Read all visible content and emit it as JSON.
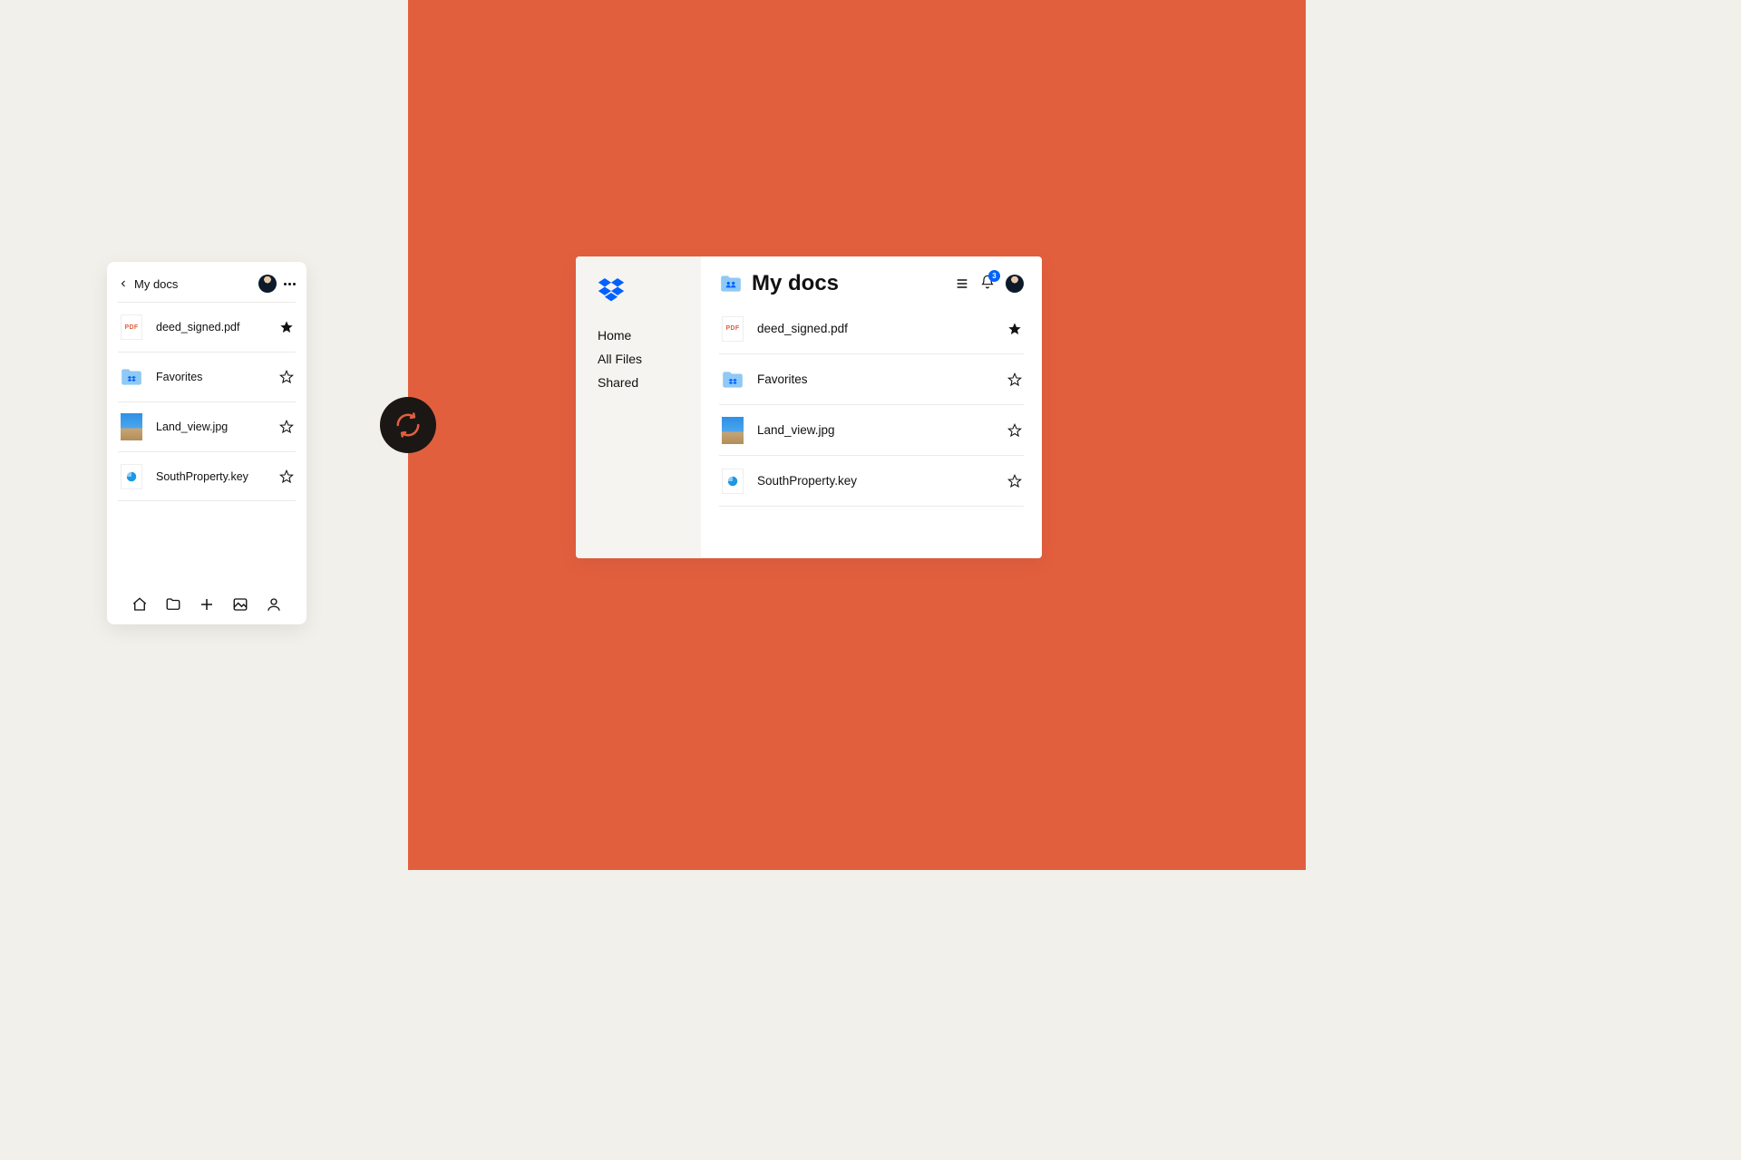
{
  "mobile": {
    "title": "My docs",
    "files": [
      {
        "name": "deed_signed.pdf",
        "type": "pdf",
        "starred": true
      },
      {
        "name": "Favorites",
        "type": "folder",
        "starred": false
      },
      {
        "name": "Land_view.jpg",
        "type": "image",
        "starred": false
      },
      {
        "name": "SouthProperty.key",
        "type": "key",
        "starred": false
      }
    ],
    "pdf_label": "PDF"
  },
  "desktop": {
    "nav": {
      "home": "Home",
      "all_files": "All Files",
      "shared": "Shared"
    },
    "title": "My docs",
    "badge": "3",
    "files": [
      {
        "name": "deed_signed.pdf",
        "type": "pdf",
        "starred": true
      },
      {
        "name": "Favorites",
        "type": "folder",
        "starred": false
      },
      {
        "name": "Land_view.jpg",
        "type": "image",
        "starred": false
      },
      {
        "name": "SouthProperty.key",
        "type": "key",
        "starred": false
      }
    ],
    "pdf_label": "PDF"
  },
  "colors": {
    "accent_orange": "#e25f3e",
    "blue": "#0061fe",
    "lightblue": "#8fc9f5"
  }
}
